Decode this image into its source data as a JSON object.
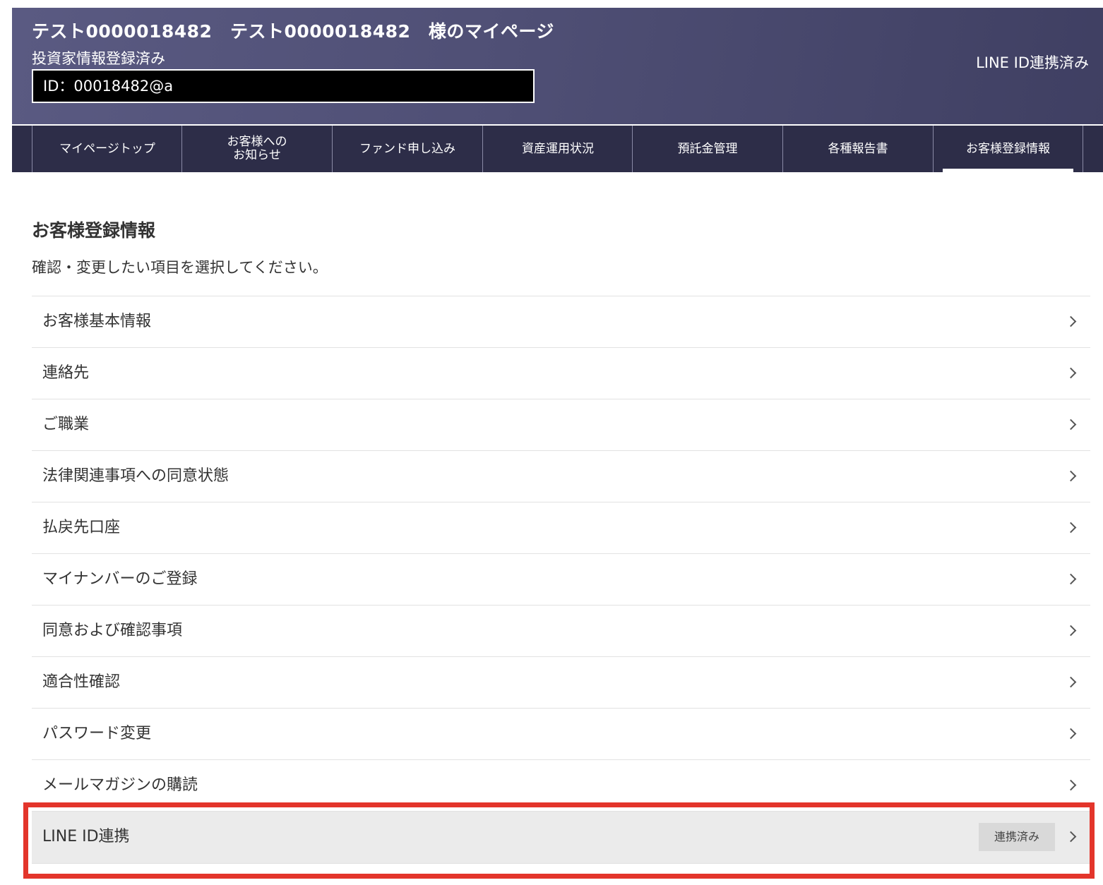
{
  "header": {
    "user_title": "テスト0000018482　テスト0000018482　様のマイページ",
    "investor_status": "投資家情報登録済み",
    "user_id": "ID：00018482@a",
    "line_status": "LINE ID連携済み"
  },
  "nav": {
    "tabs": [
      {
        "label": "マイページトップ",
        "active": false
      },
      {
        "label": "お客様への\nお知らせ",
        "active": false
      },
      {
        "label": "ファンド申し込み",
        "active": false
      },
      {
        "label": "資産運用状況",
        "active": false
      },
      {
        "label": "預託金管理",
        "active": false
      },
      {
        "label": "各種報告書",
        "active": false
      },
      {
        "label": "お客様登録情報",
        "active": true
      }
    ]
  },
  "main": {
    "title": "お客様登録情報",
    "description": "確認・変更したい項目を選択してください。",
    "items": [
      {
        "label": "お客様基本情報"
      },
      {
        "label": "連絡先"
      },
      {
        "label": "ご職業"
      },
      {
        "label": "法律関連事項への同意状態"
      },
      {
        "label": "払戻先口座"
      },
      {
        "label": "マイナンバーのご登録"
      },
      {
        "label": "同意および確認事項"
      },
      {
        "label": "適合性確認"
      },
      {
        "label": "パスワード変更"
      },
      {
        "label": "メールマガジンの購読"
      }
    ],
    "line_item": {
      "label": "LINE ID連携",
      "badge": "連携済み"
    }
  },
  "colors": {
    "header_gradient_start": "#5a5a82",
    "header_gradient_end": "#3f3f62",
    "nav_background": "#2d2d48",
    "highlight_frame": "#e3352b",
    "highlight_row": "#ebebeb",
    "badge_background": "#d9d9d9"
  },
  "icons": {
    "chevron": "chevron-right-icon"
  }
}
